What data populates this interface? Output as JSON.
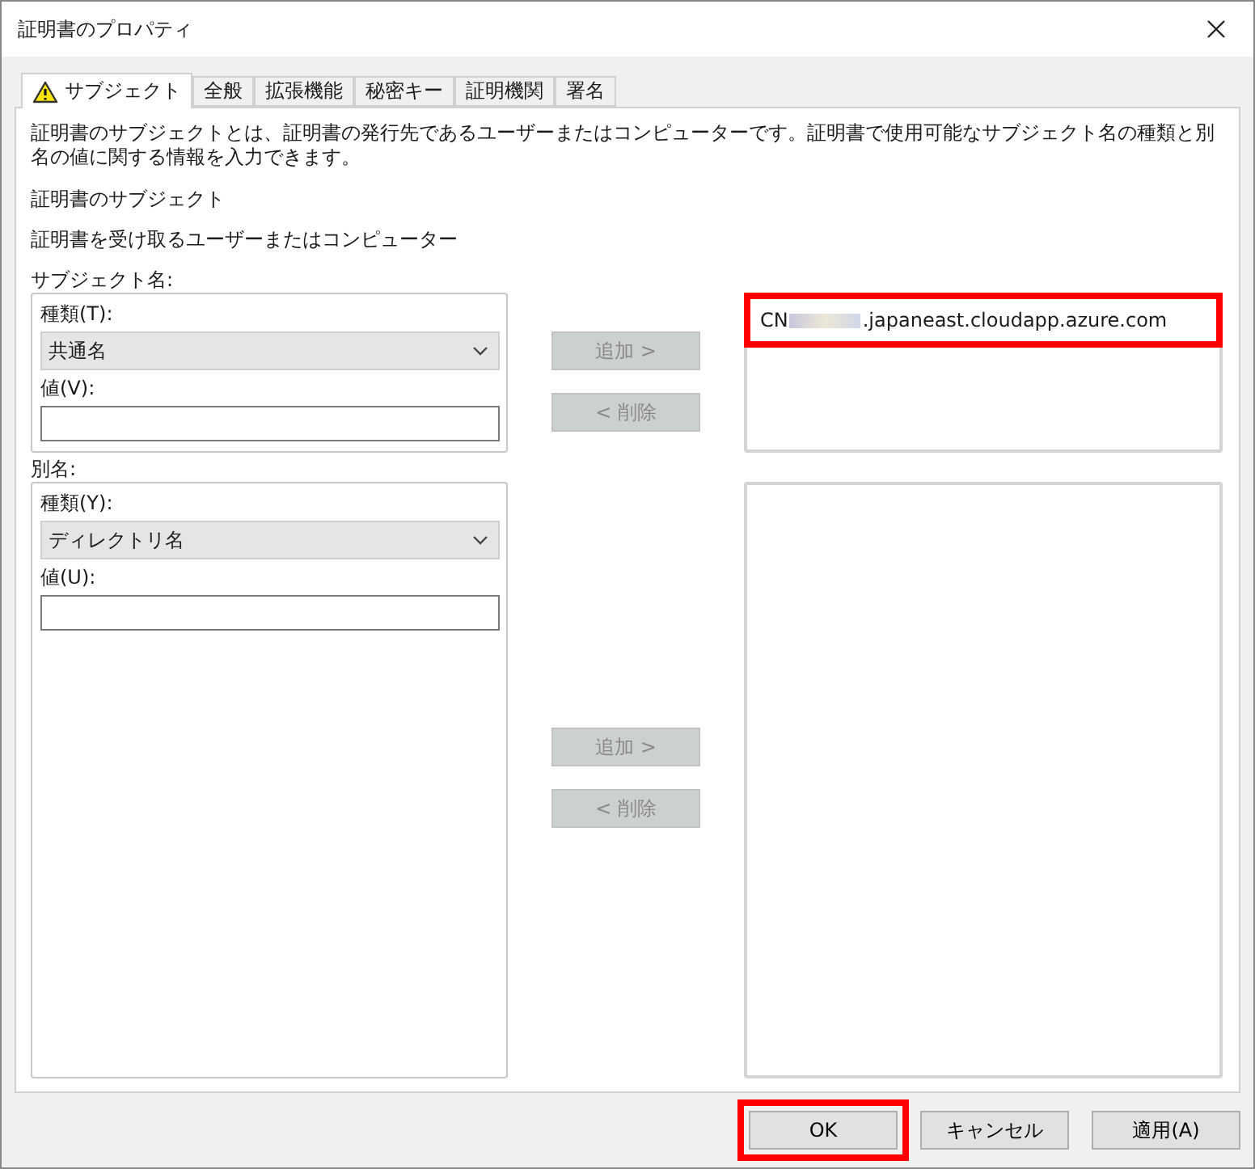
{
  "window": {
    "title": "証明書のプロパティ"
  },
  "tabs": [
    {
      "label": "サブジェクト",
      "selected": true,
      "warning": true
    },
    {
      "label": "全般",
      "selected": false,
      "warning": false
    },
    {
      "label": "拡張機能",
      "selected": false,
      "warning": false
    },
    {
      "label": "秘密キー",
      "selected": false,
      "warning": false
    },
    {
      "label": "証明機関",
      "selected": false,
      "warning": false
    },
    {
      "label": "署名",
      "selected": false,
      "warning": false
    }
  ],
  "description": "証明書のサブジェクトとは、証明書の発行先であるユーザーまたはコンピューターです。証明書で使用可能なサブジェクト名の種類と別名の値に関する情報を入力できます。",
  "section_title": "証明書のサブジェクト",
  "section_subtitle": "証明書を受け取るユーザーまたはコンピューター",
  "groups": [
    {
      "label": "サブジェクト名:",
      "type_label": "種類(T):",
      "type_value": "共通名",
      "value_label": "値(V):",
      "add": {
        "label": "追加 >",
        "disabled": true
      },
      "remove": {
        "label": "< 削除",
        "disabled": true
      },
      "entries": [
        {
          "prefix": "CN",
          "redacted": true,
          "suffix": ".japaneast.cloudapp.azure.com",
          "highlighted": true
        }
      ]
    },
    {
      "label": "別名:",
      "type_label": "種類(Y):",
      "type_value": "ディレクトリ名",
      "value_label": "値(U):",
      "add": {
        "label": "追加 >",
        "disabled": true
      },
      "remove": {
        "label": "< 削除",
        "disabled": true
      }
    }
  ],
  "buttons": [
    {
      "label": "OK",
      "highlighted": true
    },
    {
      "label": "キャンセル",
      "highlighted": false
    },
    {
      "label": "適用(A)",
      "highlighted": false
    }
  ]
}
